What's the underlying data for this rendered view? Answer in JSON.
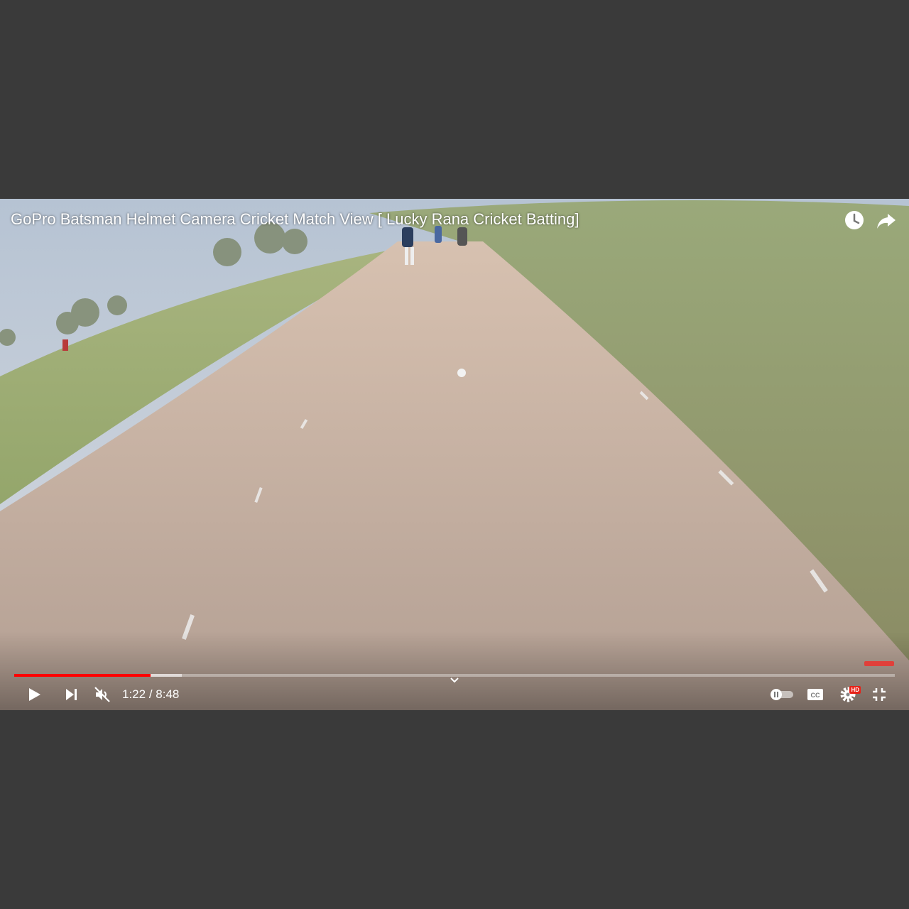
{
  "video": {
    "title": "GoPro Batsman Helmet Camera Cricket Match View [ Lucky Rana Cricket Batting]",
    "current_time": "1:22",
    "separator": " / ",
    "duration": "8:48",
    "played_fraction": 0.155,
    "buffered_fraction": 0.19
  },
  "icons": {
    "watch_later": "clock-icon",
    "share": "share-icon",
    "play": "play-icon",
    "next": "next-icon",
    "mute": "muted-volume-icon",
    "autoplay": "autoplay-toggle",
    "captions": "cc-icon",
    "settings": "gear-icon",
    "fullscreen_exit": "exit-fullscreen-icon",
    "chevron": "chevron-down-icon"
  },
  "settings_badge": "HD",
  "colors": {
    "progress_played": "#ff0000",
    "background": "#3a3a3a",
    "badge": "#e62117"
  }
}
